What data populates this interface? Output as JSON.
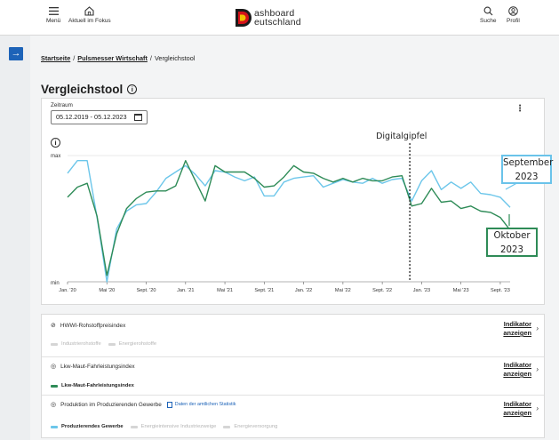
{
  "header": {
    "menu_label": "Menü",
    "focus_label": "Aktuell im Fokus",
    "logo_letter": "D",
    "logo_line1": "ashboard",
    "logo_line2": "eutschland",
    "search_label": "Suche",
    "profile_label": "Profil"
  },
  "breadcrumb": {
    "home": "Startseite",
    "section": "Pulsmesser Wirtschaft",
    "current": "Vergleichstool"
  },
  "page_title": "Vergleichstool",
  "zeitraum": {
    "label": "Zeitraum",
    "value": "05.12.2019 - 05.12.2023"
  },
  "annotations": {
    "digitalgipfel": "Digitalgipfel",
    "september": "September\n2023",
    "oktober": "Oktober\n2023",
    "september_line1": "September",
    "september_line2": "2023",
    "oktober_line1": "Oktober",
    "oktober_line2": "2023"
  },
  "colors": {
    "brand_blue": "#1d63b8",
    "series_light": "#6cc6ea",
    "series_dark": "#2e8b57",
    "callout_blue": "#6ac3ea",
    "callout_green": "#2e8b57",
    "legend_inactive": "#d5d5d5"
  },
  "chart_data": {
    "type": "line",
    "xlabel": "",
    "ylabel": "",
    "y_tick_labels": [
      "max",
      "min"
    ],
    "x_tick_labels": [
      "Jan. '20",
      "Mai '20",
      "Sept. '20",
      "Jan. '21",
      "Mai '21",
      "Sept. '21",
      "Jan. '22",
      "Mai '22",
      "Sept. '22",
      "Jan. '23",
      "Mai '23",
      "Sept. '23"
    ],
    "x_tick_months": [
      0,
      4,
      8,
      12,
      16,
      20,
      24,
      28,
      32,
      36,
      40,
      44
    ],
    "ylim": [
      0,
      100
    ],
    "event_month": 34.8,
    "series": [
      {
        "name": "Lkw-Maut-Fahrleistungsindex",
        "color": "#2e8b57",
        "x": [
          0,
          1,
          2,
          3,
          4,
          5,
          6,
          7,
          8,
          9,
          10,
          11,
          12,
          13,
          14,
          15,
          16,
          17,
          18,
          19,
          20,
          21,
          22,
          23,
          24,
          25,
          26,
          27,
          28,
          29,
          30,
          31,
          32,
          33,
          34,
          35,
          36,
          37,
          38,
          39,
          40,
          41,
          42,
          43,
          44,
          45
        ],
        "values": [
          67,
          75,
          78,
          52,
          5,
          38,
          58,
          66,
          71,
          72,
          72,
          76,
          96,
          80,
          64,
          92,
          87,
          87,
          87,
          82,
          75,
          76,
          83,
          92,
          87,
          86,
          82,
          79,
          82,
          79,
          82,
          80,
          80,
          83,
          84,
          60,
          62,
          74,
          63,
          64,
          58,
          60,
          56,
          55,
          51,
          41
        ]
      },
      {
        "name": "Produzierendes Gewerbe",
        "color": "#6cc6ea",
        "x": [
          0,
          1,
          2,
          3,
          4,
          5,
          6,
          7,
          8,
          9,
          10,
          11,
          12,
          13,
          14,
          15,
          16,
          17,
          18,
          19,
          20,
          21,
          22,
          23,
          24,
          25,
          26,
          27,
          28,
          29,
          30,
          31,
          32,
          33,
          34,
          35,
          36,
          37,
          38,
          39,
          40,
          41,
          42,
          43,
          44,
          45
        ],
        "values": [
          86,
          96,
          96,
          51,
          0,
          42,
          56,
          61,
          62,
          71,
          82,
          87,
          92,
          85,
          76,
          88,
          87,
          83,
          80,
          83,
          68,
          68,
          79,
          82,
          83,
          84,
          75,
          78,
          81,
          79,
          78,
          82,
          78,
          81,
          82,
          64,
          80,
          88,
          73,
          79,
          74,
          79,
          70,
          69,
          67,
          59
        ]
      }
    ]
  },
  "indicators": [
    {
      "title": "HWWI-Rohstoffpreisindex",
      "eye": "hidden",
      "legend": [
        {
          "label": "Industrierohstoffe",
          "color": "#d5d5d5",
          "active": false
        },
        {
          "label": "Energierohstoffe",
          "color": "#d5d5d5",
          "active": false
        }
      ],
      "link_line1": "Indikator",
      "link_line2": "anzeigen"
    },
    {
      "title": "Lkw-Maut-Fahrleistungsindex",
      "eye": "visible",
      "legend": [
        {
          "label": "Lkw-Maut-Fahrleistungsindex",
          "color": "#2e8b57",
          "active": true
        }
      ],
      "link_line1": "Indikator",
      "link_line2": "anzeigen"
    },
    {
      "title": "Produktion im Produzierenden Gewerbe",
      "eye": "visible",
      "badge": "Daten der amtlichen Statistik",
      "legend": [
        {
          "label": "Produzierendes Gewerbe",
          "color": "#6cc6ea",
          "active": true
        },
        {
          "label": "Energieintensive Industriezweige",
          "color": "#d5d5d5",
          "active": false
        },
        {
          "label": "Energieversorgung",
          "color": "#d5d5d5",
          "active": false
        }
      ],
      "link_line1": "Indikator",
      "link_line2": "anzeigen"
    }
  ]
}
